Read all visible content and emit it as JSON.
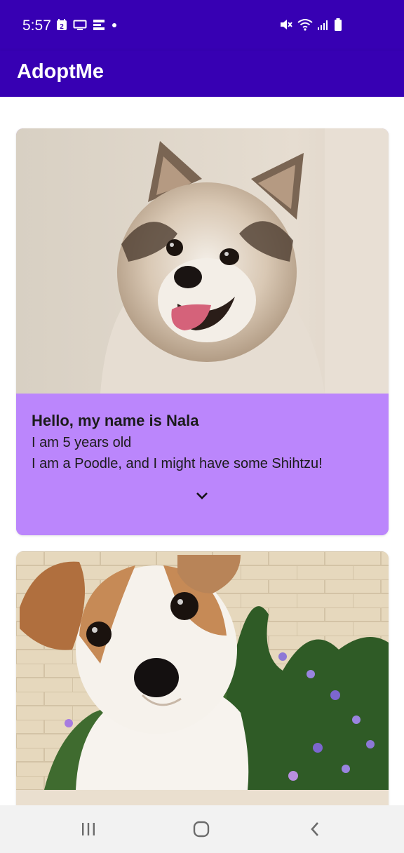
{
  "status_bar": {
    "time": "5:57",
    "calendar_day": "2",
    "left_icons": [
      "calendar-icon",
      "monitor-icon",
      "app-notification-icon",
      "dot-icon"
    ],
    "right_icons": [
      "vibrate-mute-icon",
      "wifi-icon",
      "signal-icon",
      "battery-icon"
    ]
  },
  "app_bar": {
    "title": "AdoptMe",
    "color": "#3700b3"
  },
  "cards": [
    {
      "heading": "Hello, my name is Nala",
      "age_line": "I am 5 years old",
      "breed_line": "I am a Poodle, and I might have some Shihtzu!",
      "expand_icon": "chevron-down-icon",
      "color": "#bb86fc",
      "image": "fluffy-dog-photo"
    },
    {
      "image": "puppy-with-flowers-photo"
    }
  ],
  "nav_bar": {
    "buttons": [
      "recents-icon",
      "home-icon",
      "back-icon"
    ]
  }
}
